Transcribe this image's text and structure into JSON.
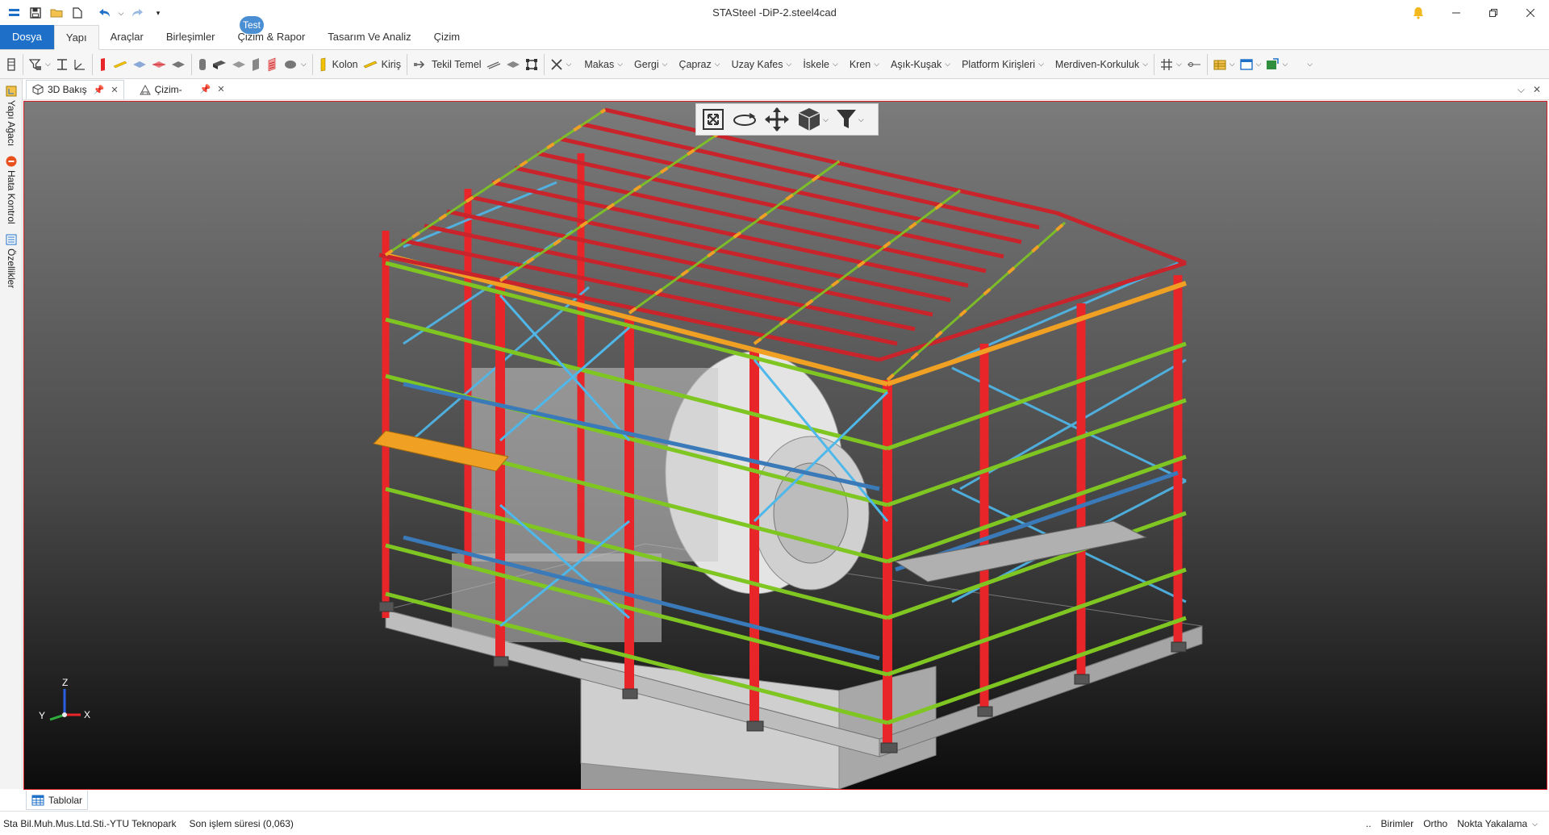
{
  "app": {
    "title": "STASteel -DiP-2.steel4cad"
  },
  "colors": {
    "accent": "#1e6fc8",
    "badge": "#4a8fd4",
    "viewport_border": "#d4202a",
    "column_red": "#e8262a",
    "girt_green": "#7fc623",
    "brace_blue": "#4fb8ea",
    "purlin_red": "#c9232b",
    "eave_orange": "#f0a023"
  },
  "quick_access": [
    "menu-icon",
    "save-icon",
    "open-folder-icon",
    "new-file-icon",
    "undo-icon",
    "redo-icon",
    "customize-icon"
  ],
  "menu": {
    "items": [
      "Dosya",
      "Yapı",
      "Araçlar",
      "Birleşimler",
      "Çizim & Rapor",
      "Tasarım Ve Analiz",
      "Çizim"
    ],
    "active_index": 1,
    "badge": "Test"
  },
  "toolbar": {
    "kolon": "Kolon",
    "kiris": "Kiriş",
    "tekil_temel": "Tekil Temel",
    "makas": "Makas",
    "gergi": "Gergi",
    "capraz": "Çapraz",
    "uzay_kafes": "Uzay Kafes",
    "iskele": "İskele",
    "kren": "Kren",
    "asik_kusak": "Aşık-Kuşak",
    "platform": "Platform Kirişleri",
    "merdiven": "Merdiven-Korkuluk"
  },
  "doc_tabs": {
    "tab1": "3D Bakış",
    "tab2": "Çizim-",
    "pin": "📌",
    "close": "✕"
  },
  "left_panel": {
    "tab1": "Yapı Ağacı",
    "tab2": "Hata Kontrol",
    "tab3": "Özellikler"
  },
  "axes": {
    "z": "Z",
    "y": "Y",
    "x": "X"
  },
  "bottom": {
    "tablolar": "Tablolar"
  },
  "status": {
    "company": "Sta Bil.Muh.Mus.Ltd.Sti.-YTU Teknopark",
    "last_op": "Son işlem süresi (0,063)",
    "dots": "..",
    "birimler": "Birimler",
    "ortho": "Ortho",
    "nokta": "Nokta Yakalama"
  }
}
